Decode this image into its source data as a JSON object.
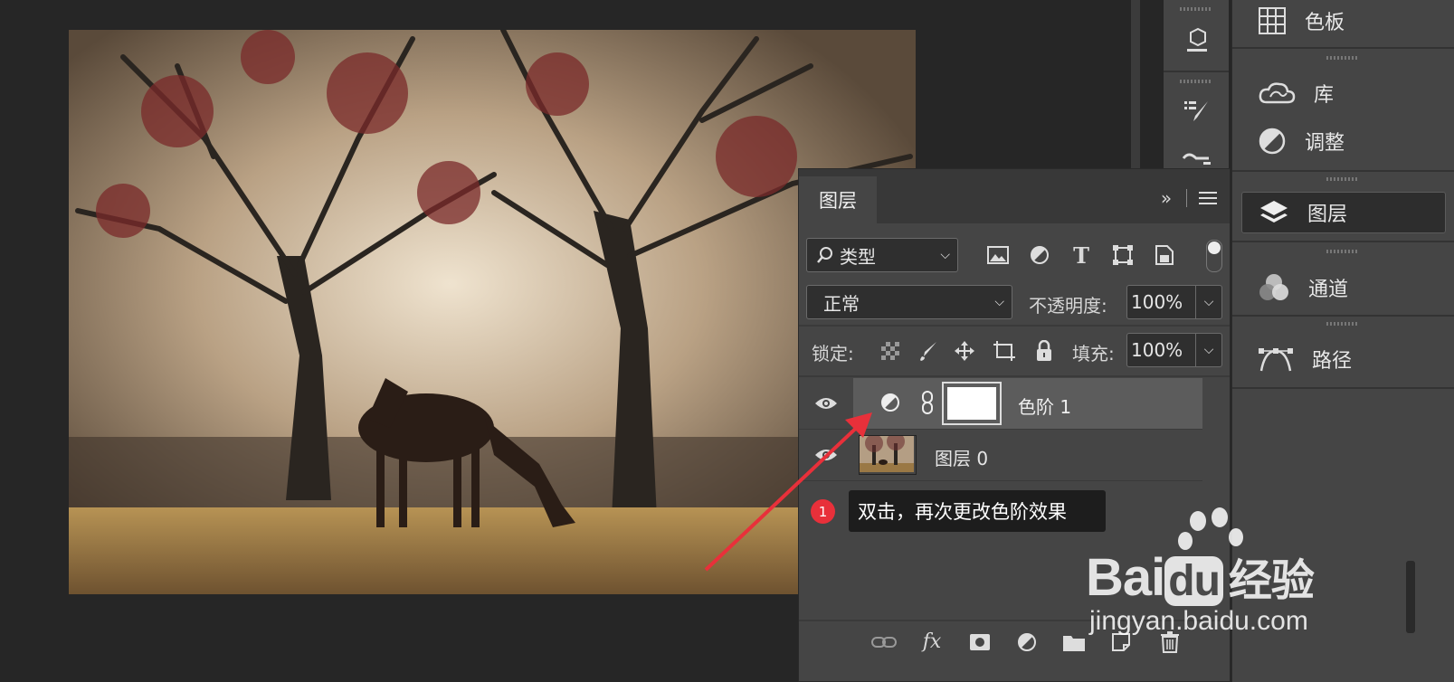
{
  "dock": {
    "items": [
      {
        "label": "色板",
        "icon": "swatches-grid-icon"
      },
      {
        "label": "库",
        "icon": "cc-libraries-icon"
      },
      {
        "label": "调整",
        "icon": "adjustments-icon"
      },
      {
        "label": "图层",
        "icon": "layers-icon"
      },
      {
        "label": "通道",
        "icon": "channels-icon"
      },
      {
        "label": "路径",
        "icon": "paths-icon"
      }
    ]
  },
  "layers_panel": {
    "tab_label": "图层",
    "expand_symbol": "»",
    "filter_label": "类型",
    "blend_mode": "正常",
    "opacity_label": "不透明度:",
    "opacity_value": "100%",
    "lock_label": "锁定:",
    "fill_label": "填充:",
    "fill_value": "100%",
    "layers": [
      {
        "name": "色阶 1",
        "type": "adjustment",
        "visible": true,
        "selected": true
      },
      {
        "name": "图层 0",
        "type": "image",
        "visible": true,
        "selected": false
      }
    ],
    "footer_fx": "fx"
  },
  "annotation": {
    "badge_number": "1",
    "tooltip_text": "双击，再次更改色阶效果",
    "arrow_color": "#e8303a"
  },
  "watermark": {
    "brand": "Bai",
    "brand_du": "du",
    "product": "经验",
    "url": "jingyan.baidu.com"
  }
}
